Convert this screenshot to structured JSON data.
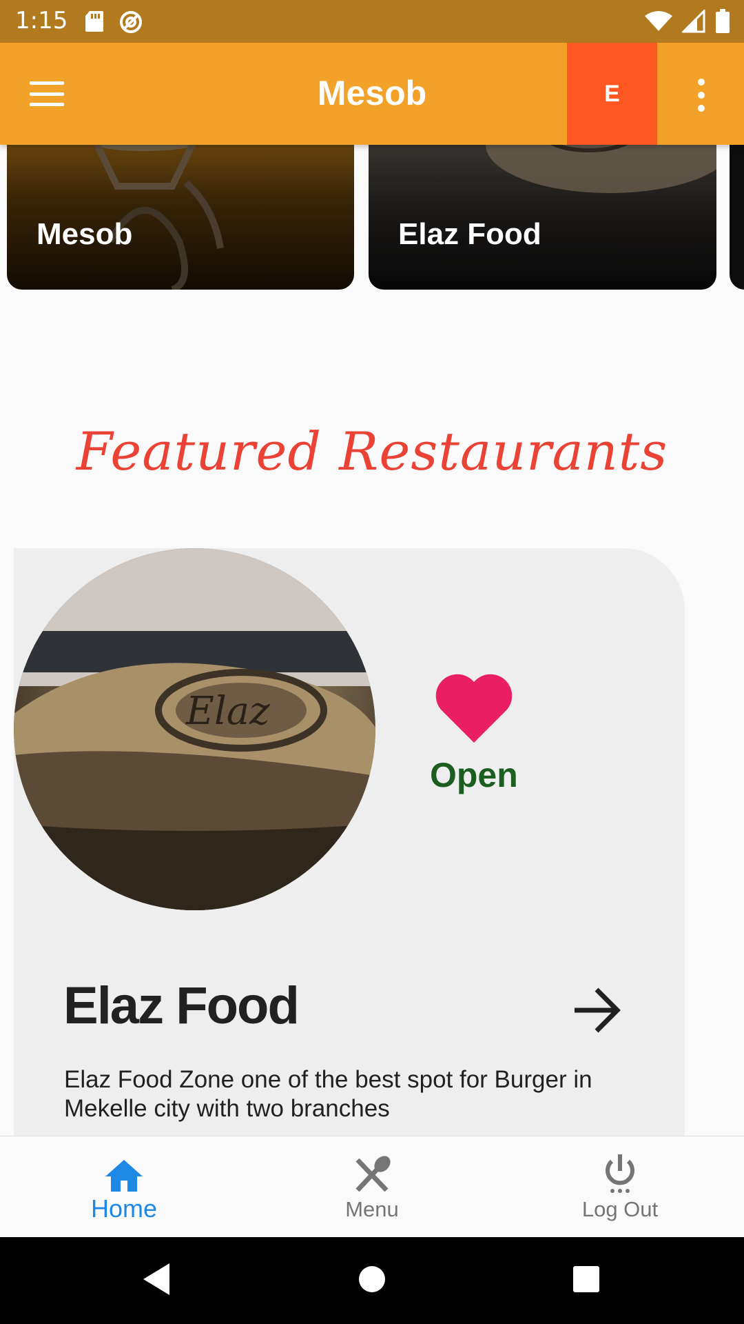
{
  "status_bar": {
    "time": "1:15",
    "left_icons": [
      "sd-card-icon",
      "at-sign-icon"
    ],
    "right_icons": [
      "wifi-icon",
      "signal-icon",
      "battery-icon"
    ]
  },
  "app_bar": {
    "title": "Mesob",
    "user_initial": "E",
    "menu_icon": "hamburger-icon",
    "more_icon": "more-vertical-icon",
    "colors": {
      "background": "#f2a129",
      "badge": "#ff5722"
    }
  },
  "restaurant_carousel": [
    {
      "name": "Mesob"
    },
    {
      "name": "Elaz Food"
    }
  ],
  "featured": {
    "heading": "Featured Restaurants",
    "heading_color": "#ea4335",
    "card": {
      "name": "Elaz Food",
      "status": "Open",
      "status_color": "#1b5e20",
      "favorite_color": "#e91e63",
      "description": "Elaz Food Zone one of the best spot for Burger in Mekelle city with two branches"
    }
  },
  "bottom_nav": {
    "items": [
      {
        "label": "Home",
        "icon": "home-icon",
        "active": true
      },
      {
        "label": "Menu",
        "icon": "utensils-icon",
        "active": false
      },
      {
        "label": "Log Out",
        "icon": "power-icon",
        "active": false
      }
    ],
    "active_color": "#1e88e5"
  },
  "system_nav": [
    "back-icon",
    "home-circle-icon",
    "recents-icon"
  ]
}
